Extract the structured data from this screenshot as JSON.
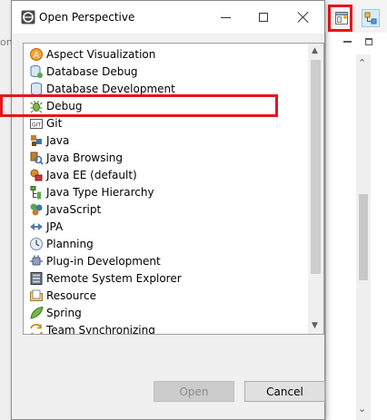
{
  "background": {
    "left_tab_fragment": "ont",
    "toolbar": {
      "open_perspective_icon": "open-perspective-icon",
      "java_perspective_icon": "java-perspective-icon"
    }
  },
  "dialog": {
    "title": "Open Perspective",
    "items": [
      {
        "label": "Aspect Visualization",
        "icon": "aspect-visualization-icon"
      },
      {
        "label": "Database Debug",
        "icon": "database-debug-icon"
      },
      {
        "label": "Database Development",
        "icon": "database-development-icon"
      },
      {
        "label": "Debug",
        "icon": "debug-icon"
      },
      {
        "label": "Git",
        "icon": "git-icon"
      },
      {
        "label": "Java",
        "icon": "java-icon"
      },
      {
        "label": "Java Browsing",
        "icon": "java-browsing-icon"
      },
      {
        "label": "Java EE (default)",
        "icon": "java-ee-icon"
      },
      {
        "label": "Java Type Hierarchy",
        "icon": "java-type-hierarchy-icon"
      },
      {
        "label": "JavaScript",
        "icon": "javascript-icon"
      },
      {
        "label": "JPA",
        "icon": "jpa-icon"
      },
      {
        "label": "Planning",
        "icon": "planning-icon"
      },
      {
        "label": "Plug-in Development",
        "icon": "plugin-development-icon"
      },
      {
        "label": "Remote System Explorer",
        "icon": "remote-system-explorer-icon"
      },
      {
        "label": "Resource",
        "icon": "resource-icon"
      },
      {
        "label": "Spring",
        "icon": "spring-icon"
      },
      {
        "label": "Team Synchronizing",
        "icon": "team-synchronizing-icon"
      }
    ],
    "buttons": {
      "open": "Open",
      "cancel": "Cancel"
    }
  },
  "colors": {
    "highlight": "#e8141b",
    "disabled_text": "#8c8c8c"
  }
}
